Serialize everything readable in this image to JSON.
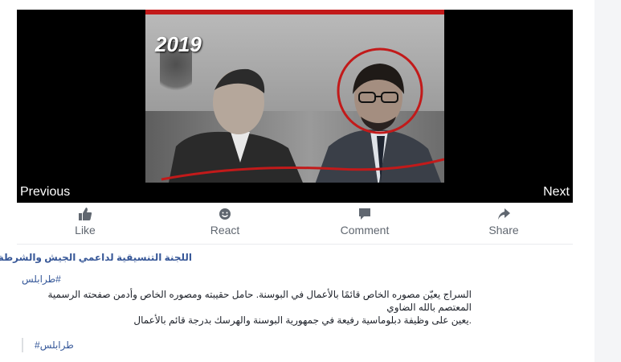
{
  "viewer": {
    "photo_caption_year": "2019",
    "prev_label": "Previous",
    "next_label": "Next"
  },
  "actions": {
    "like": "Like",
    "react": "React",
    "comment": "Comment",
    "share": "Share"
  },
  "post": {
    "page_name": "اللجنة التنسيقية لداعمي الجيش والشرطة",
    "hashtag": "#طرابلس",
    "lines": [
      "السراج يعيّن مصوره الخاص قائمًا بالأعمال في البوسنة. حامل حقيبته ومصوره الخاص وأدمن صفحته الرسمية",
      "المعتصم بالله الضاوي",
      ".يعين على وظيفة دبلوماسية رفيعة في جمهورية البوسنة والهرسك بدرجة قائم بالأعمال"
    ],
    "quote_hashtag": "#طرابلس"
  },
  "colors": {
    "accent_red": "#c21a1a",
    "link": "#365899",
    "icon_gray": "#606770"
  },
  "icons": [
    "thumbs-up-icon",
    "smile-icon",
    "comment-bubble-icon",
    "share-arrow-icon"
  ]
}
